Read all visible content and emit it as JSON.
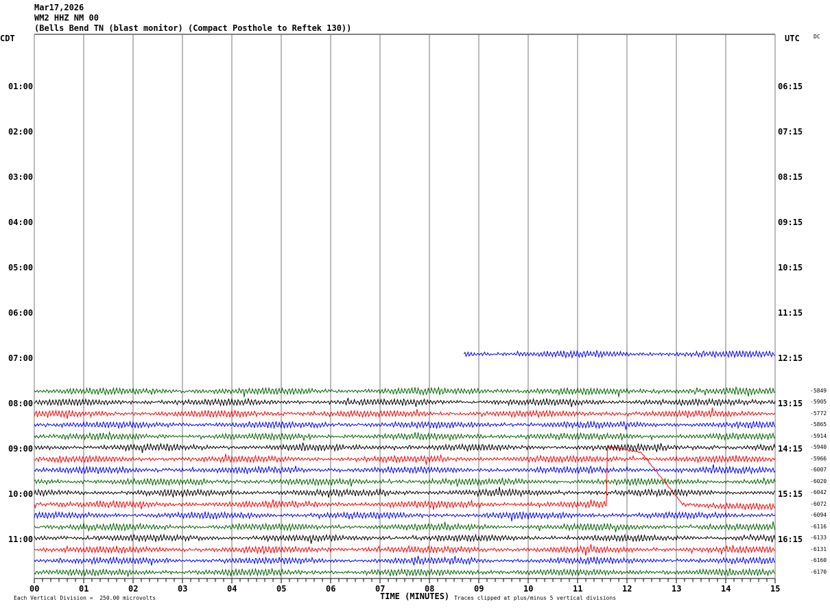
{
  "chart_data": {
    "type": "line",
    "title_lines": [
      "Mar17,2026",
      "WM2 HHZ NM 00",
      "(Bells Bend TN (blast monitor) (Compact Posthole to Reftek 130))"
    ],
    "left_timezone": "CDT",
    "right_timezone": "UTC",
    "dc_label": "DC",
    "left_hour_labels": [
      "01:00",
      "02:00",
      "03:00",
      "04:00",
      "05:00",
      "06:00",
      "07:00",
      "08:00",
      "09:00",
      "10:00",
      "11:00"
    ],
    "right_hour_labels": [
      "06:15",
      "07:15",
      "08:15",
      "09:15",
      "10:15",
      "11:15",
      "12:15",
      "13:15",
      "14:15",
      "15:15",
      "16:15"
    ],
    "x_ticks": [
      "00",
      "01",
      "02",
      "03",
      "04",
      "05",
      "06",
      "07",
      "08",
      "09",
      "10",
      "11",
      "12",
      "13",
      "14",
      "15"
    ],
    "xlabel": "TIME (MINUTES)",
    "xlim": [
      0,
      15
    ],
    "scale_note": "Each Vertical Division =  250.00 microvolts",
    "clip_note": "Traces clipped at plus/minus 5 vertical divisions",
    "trace_colors": [
      "#000000",
      "#ff0000",
      "#0000ff",
      "#006400"
    ],
    "traces": [
      {
        "row_start": "07:00",
        "color": "#0000ff",
        "start_minute": 8.7,
        "offset": ""
      },
      {
        "color": "#006400",
        "offset": "-5849"
      },
      {
        "color": "#000000",
        "offset": "-5905"
      },
      {
        "color": "#ff0000",
        "offset": "-5772"
      },
      {
        "color": "#0000ff",
        "offset": "-5865"
      },
      {
        "color": "#006400",
        "offset": "-5914"
      },
      {
        "color": "#000000",
        "offset": "-5940"
      },
      {
        "color": "#ff0000",
        "offset": "-5966"
      },
      {
        "color": "#0000ff",
        "offset": "-6007"
      },
      {
        "color": "#006400",
        "offset": "-6020"
      },
      {
        "color": "#000000",
        "offset": "-6042"
      },
      {
        "color": "#ff0000",
        "offset": "-6072",
        "event_minute": 11.6
      },
      {
        "color": "#0000ff",
        "offset": "-6094"
      },
      {
        "color": "#006400",
        "offset": "-6116"
      },
      {
        "color": "#000000",
        "offset": "-6133"
      },
      {
        "color": "#ff0000",
        "offset": "-6131"
      },
      {
        "color": "#0000ff",
        "offset": "-6160"
      },
      {
        "color": "#006400",
        "offset": "-6170"
      }
    ]
  }
}
